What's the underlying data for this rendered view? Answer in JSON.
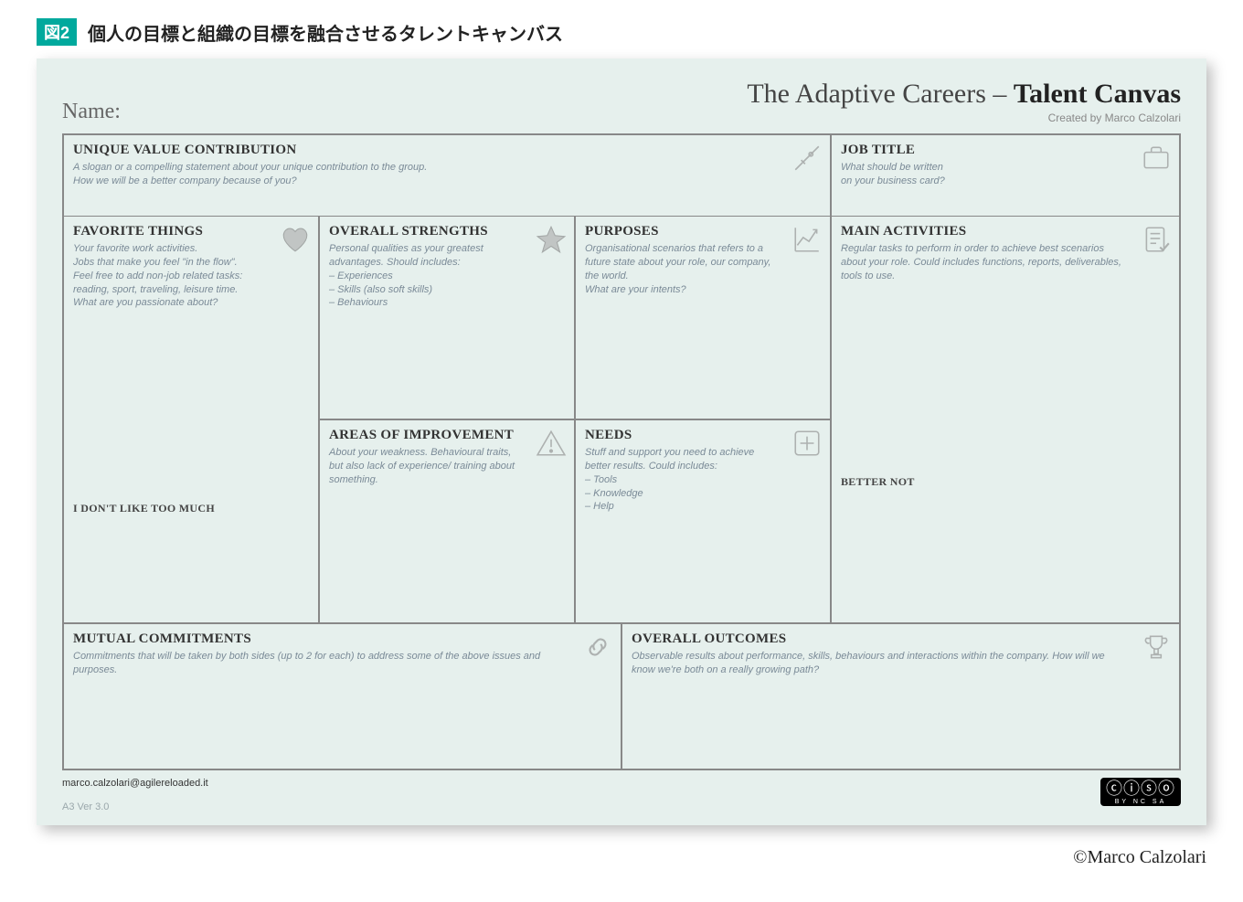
{
  "figure": {
    "badge": "図2",
    "title": "個人の目標と組織の目標を融合させるタレントキャンバス"
  },
  "header": {
    "name_label": "Name:",
    "title_prefix": "The Adaptive Careers – ",
    "title_strong": "Talent Canvas",
    "created_by": "Created by Marco Calzolari"
  },
  "cells": {
    "uvc": {
      "title": "UNIQUE VALUE CONTRIBUTION",
      "desc": "A slogan or a compelling statement about your unique contribution to the group.\nHow we will be a better company because of you?"
    },
    "job": {
      "title": "JOB TITLE",
      "desc": "What should be written\non your business card?"
    },
    "fav": {
      "title": "FAVORITE THINGS",
      "desc": "Your favorite work activities.\nJobs that make you feel \"in the flow\".\nFeel free to add non-job related tasks:\nreading, sport, traveling, leisure time.\nWhat are you passionate about?",
      "sub": "I DON'T LIKE TOO MUCH"
    },
    "strengths": {
      "title": "OVERALL STRENGTHS",
      "desc": "Personal qualities as your greatest advantages. Should includes:\n– Experiences\n– Skills (also soft skills)\n– Behaviours"
    },
    "improve": {
      "title": "AREAS OF IMPROVEMENT",
      "desc": "About your weakness. Behavioural traits, but also lack of experience/ training about something."
    },
    "purposes": {
      "title": "PURPOSES",
      "desc": "Organisational scenarios that refers to a future state about your role, our company, the world.\nWhat are your intents?"
    },
    "needs": {
      "title": "NEEDS",
      "desc": "Stuff and support you need to achieve better results. Could includes:\n– Tools\n– Knowledge\n– Help"
    },
    "activities": {
      "title": "MAIN ACTIVITIES",
      "desc": "Regular tasks to perform in order to achieve best scenarios about your role. Could includes functions, reports, deliverables, tools to use.",
      "sub": "BETTER NOT"
    },
    "commit": {
      "title": "MUTUAL COMMITMENTS",
      "desc": "Commitments that will be taken by both sides (up to 2 for each) to address some of the above issues and purposes."
    },
    "outcomes": {
      "title": "OVERALL OUTCOMES",
      "desc": "Observable results about performance, skills, behaviours and interactions within the company. How will we know we're both on a really growing path?"
    }
  },
  "footer": {
    "email": "marco.calzolari@agilereloaded.it",
    "version": "A3 Ver 3.0",
    "cc_icons": "ⓒⓘⓢⓞ",
    "cc_labels": "BY   NC   SA"
  },
  "credit": "©Marco Calzolari"
}
